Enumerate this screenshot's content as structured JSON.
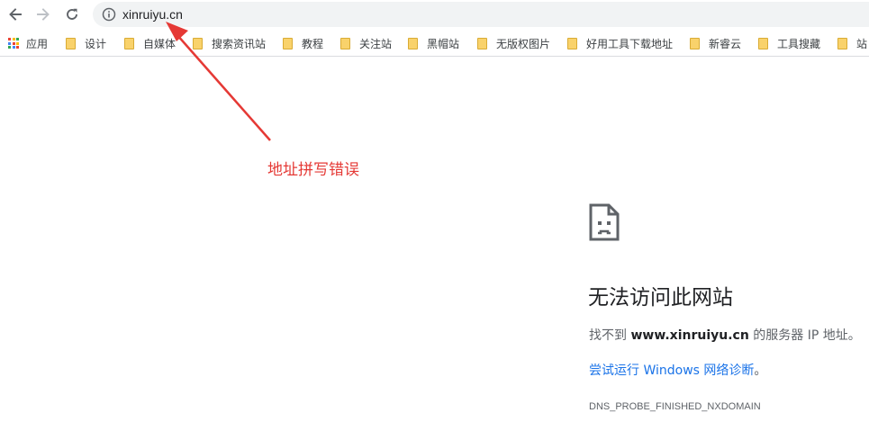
{
  "omnibox": {
    "url": "xinruiyu.cn"
  },
  "bookmarks": {
    "apps_label": "应用",
    "apps_colors": [
      "#ea4335",
      "#fbbc05",
      "#34a853",
      "#4285f4",
      "#ea4335",
      "#fbbc05",
      "#34a853",
      "#4285f4",
      "#ea4335"
    ],
    "items": [
      {
        "label": "设计"
      },
      {
        "label": "自媒体"
      },
      {
        "label": "搜索资讯站"
      },
      {
        "label": "教程"
      },
      {
        "label": "关注站"
      },
      {
        "label": "黑帽站"
      },
      {
        "label": "无版权图片"
      },
      {
        "label": "好用工具下载地址"
      },
      {
        "label": "新睿云"
      },
      {
        "label": "工具搜藏"
      },
      {
        "label": "站"
      }
    ]
  },
  "error": {
    "title": "无法访问此网站",
    "desc_prefix": "找不到 ",
    "desc_host": "www.xinruiyu.cn",
    "desc_suffix": " 的服务器 IP 地址。",
    "link_prefix": "尝试运行 Windows 网络诊断",
    "link_suffix": "。",
    "code": "DNS_PROBE_FINISHED_NXDOMAIN"
  },
  "annotation": {
    "text": "地址拼写错误",
    "color": "#e53935"
  }
}
